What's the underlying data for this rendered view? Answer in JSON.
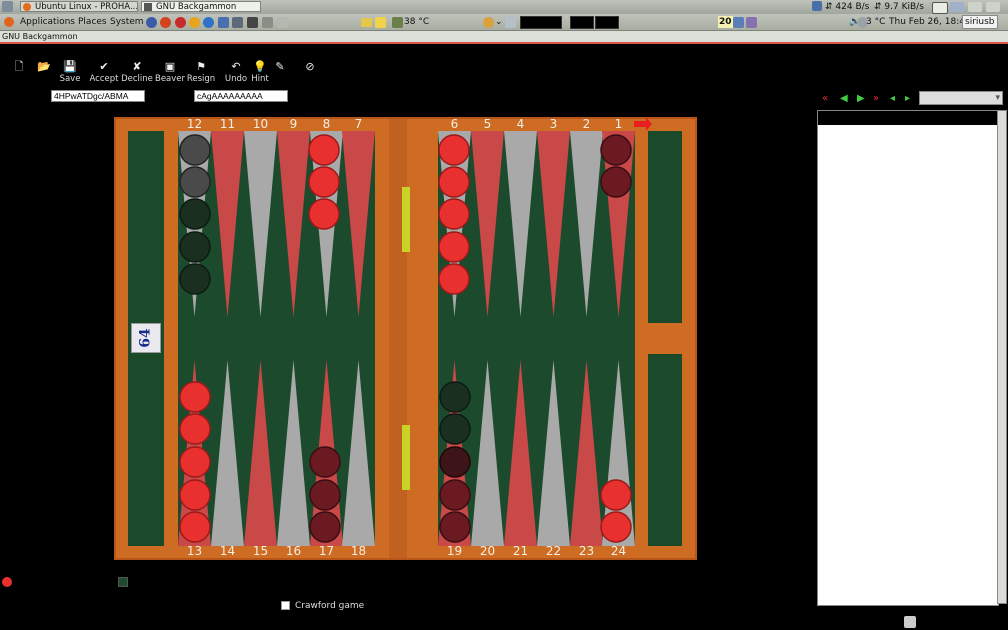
{
  "topbar": {
    "tasks": [
      {
        "label": "Ubuntu Linux - PROHA...",
        "active": false
      },
      {
        "label": "GNU Backgammon",
        "active": true
      }
    ],
    "net_down": "424 B/s",
    "net_up": "9.7 KiB/s"
  },
  "menubar": {
    "applications": "Applications",
    "places": "Places",
    "system": "System",
    "temp_cpu": "38 °C",
    "badge": "20",
    "weather": "3 °C",
    "clock": "Thu Feb 26, 18:49",
    "user": "siriusb"
  },
  "window": {
    "title": "GNU Backgammon"
  },
  "toolbar": {
    "save": "Save",
    "accept": "Accept",
    "decline": "Decline",
    "beaver": "Beaver",
    "resign": "Resign",
    "undo": "Undo",
    "hint": "Hint"
  },
  "position_id": "4HPwATDgc/ABMA",
  "match_id": "cAgAAAAAAAAA",
  "board": {
    "top_numbers": [
      "12",
      "11",
      "10",
      "9",
      "8",
      "7",
      "6",
      "5",
      "4",
      "3",
      "2",
      "1"
    ],
    "bottom_numbers": [
      "13",
      "14",
      "15",
      "16",
      "17",
      "18",
      "19",
      "20",
      "21",
      "22",
      "23",
      "24"
    ],
    "cube_value": "64",
    "colors": {
      "red_checker": "#e8302f",
      "dark_checker": "#6b1a22",
      "felt": "#1c4a2c",
      "wood": "#c8641c"
    }
  },
  "footer": {
    "crawford_label": "Crawford game"
  }
}
